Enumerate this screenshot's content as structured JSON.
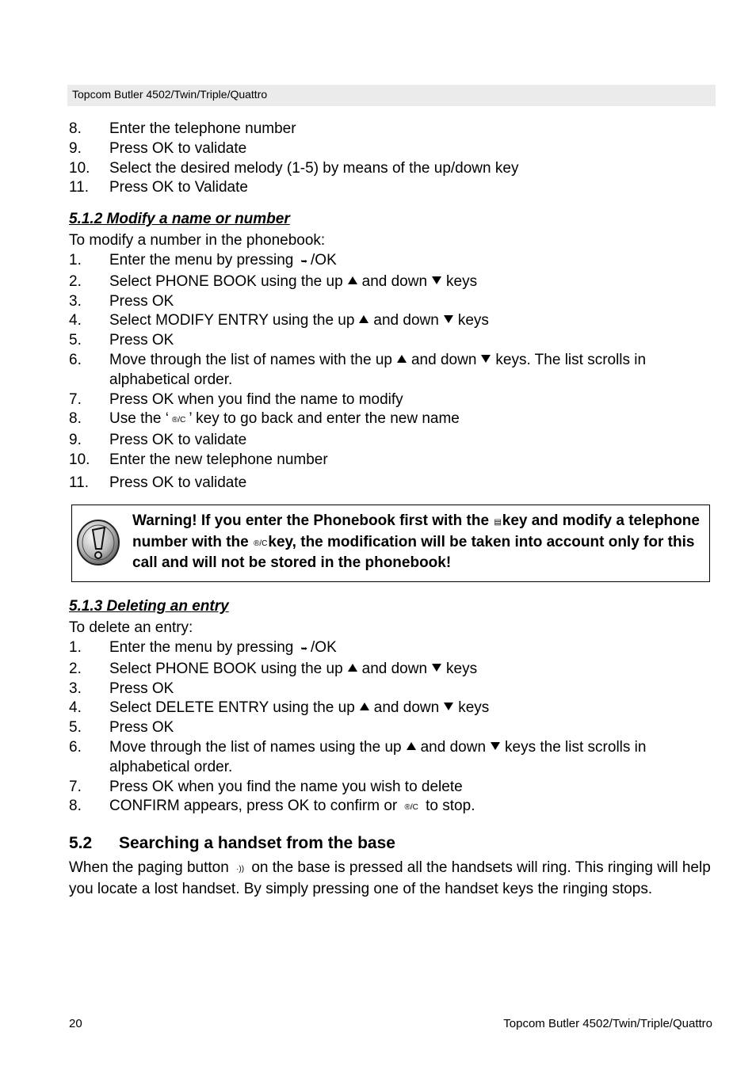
{
  "header": {
    "title": "Topcom Butler 4502/Twin/Triple/Quattro"
  },
  "top_list": [
    {
      "num": "8.",
      "text": "Enter the telephone number"
    },
    {
      "num": "9.",
      "text": "Press OK to validate"
    },
    {
      "num": "10.",
      "text": "Select the desired melody (1-5) by means of the up/down key"
    },
    {
      "num": "11.",
      "text": "Press OK to Validate"
    }
  ],
  "modify": {
    "heading": "5.1.2 Modify a name or number",
    "intro": "To modify a number in the phonebook:",
    "steps": [
      {
        "num": "1.",
        "a": "Enter the menu by pressing",
        "b": "/OK"
      },
      {
        "num": "2.",
        "a": "Select PHONE BOOK using the up",
        "b": "and down",
        "c": "keys"
      },
      {
        "num": "3.",
        "a": "Press OK"
      },
      {
        "num": "4.",
        "a": "Select MODIFY ENTRY using the up",
        "b": "and down",
        "c": "keys"
      },
      {
        "num": "5.",
        "a": "Press OK"
      },
      {
        "num": "6.",
        "a": "Move through the list of names with the up",
        "b": "and down",
        "c": "keys. The list scrolls in alphabetical order."
      },
      {
        "num": "7.",
        "a": "Press OK when you find the name to modify"
      },
      {
        "num": "8.",
        "a": "Use the ‘",
        "b": "’ key to go back and enter the new name"
      },
      {
        "num": "9.",
        "a": "Press OK to validate"
      },
      {
        "num": "10.",
        "a": "Enter the new telephone number"
      },
      {
        "num": "11.",
        "a": "Press OK to validate"
      }
    ]
  },
  "warning": {
    "part1": "Warning! If you enter the Phonebook first with the",
    "part2": "key and modify a telephone number with the",
    "part3": "key, the modification will be taken into account only for this call and will not be stored in the phonebook!"
  },
  "delete": {
    "heading": "5.1.3 Deleting an entry",
    "intro": "To delete an entry:",
    "steps": [
      {
        "num": "1.",
        "a": "Enter the menu by pressing",
        "b": "/OK"
      },
      {
        "num": "2.",
        "a": "Select PHONE BOOK using the up",
        "b": "and down",
        "c": "keys"
      },
      {
        "num": "3.",
        "a": "Press OK"
      },
      {
        "num": "4.",
        "a": "Select DELETE ENTRY using the up",
        "b": "and down",
        "c": "keys"
      },
      {
        "num": "5.",
        "a": "Press OK"
      },
      {
        "num": "6.",
        "a": "Move through the list of names using the up",
        "b": "and down",
        "c": "keys the list scrolls in alphabetical order."
      },
      {
        "num": "7.",
        "a": "Press OK when you find the name you wish to delete"
      },
      {
        "num": "8.",
        "a": "CONFIRM appears, press OK to confirm or",
        "b": "to stop."
      }
    ]
  },
  "section52": {
    "number": "5.2",
    "title": "Searching a handset from the base",
    "text_a": "When the paging button",
    "text_b": "on the base is pressed all the handsets will ring. This ringing will help you locate a lost handset. By simply pressing one of the handset keys the ringing stops."
  },
  "icons": {
    "menu_key": "⮊",
    "clear_key": "®/C",
    "phonebook_key": "🕮",
    "paging_key": "·))"
  },
  "footer": {
    "page_number": "20",
    "title": "Topcom Butler 4502/Twin/Triple/Quattro"
  }
}
